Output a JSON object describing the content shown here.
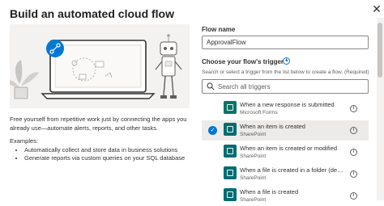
{
  "dialog": {
    "title": "Build an automated cloud flow",
    "close_glyph": "✕"
  },
  "left": {
    "description": "Free yourself from repetitive work just by connecting the apps you already use—automate alerts, reports, and other tasks.",
    "examples_label": "Examples:",
    "examples": [
      "Automatically collect and store data in business solutions",
      "Generate reports via custom queries on your SQL database"
    ]
  },
  "form": {
    "flow_name_label": "Flow name",
    "flow_name_value": "ApprovalFlow",
    "trigger_label": "Choose your flow's trigger",
    "required_mark": "*",
    "info_glyph": "i",
    "hint": "Search or select a trigger from the list below to create a flow. (Required)",
    "search_placeholder": "Search all triggers",
    "selected_check": "✓"
  },
  "triggers": [
    {
      "name": "When a new response is submitted",
      "connector": "Microsoft Forms",
      "icon": "forms-icon",
      "selected": false
    },
    {
      "name": "When an item is created",
      "connector": "SharePoint",
      "icon": "sharepoint-icon",
      "selected": true
    },
    {
      "name": "When an item is created or modified",
      "connector": "SharePoint",
      "icon": "sharepoint-icon",
      "selected": false
    },
    {
      "name": "When a file is created in a folder (de…",
      "connector": "SharePoint",
      "icon": "sharepoint-icon",
      "selected": false
    },
    {
      "name": "When a file is created",
      "connector": "SharePoint",
      "icon": "sharepoint-icon",
      "selected": false
    }
  ],
  "colors": {
    "accent": "#0078d4",
    "selected_row": "#edebe9",
    "sharepoint": "#036c70",
    "forms": "#077568"
  }
}
